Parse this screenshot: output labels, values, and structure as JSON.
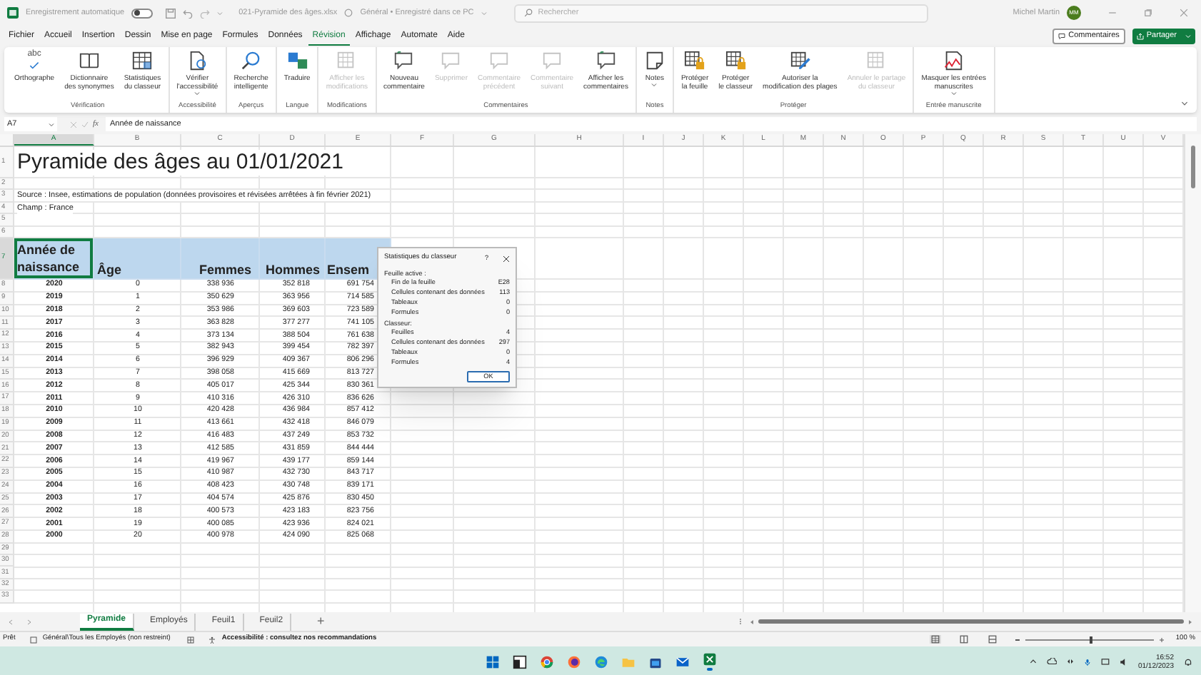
{
  "title_bar": {
    "autosave": {
      "label": "Enregistrement automatique",
      "on": false
    },
    "file_name": "021-Pyramide des âges.xlsx",
    "location": "Général • Enregistré dans ce PC",
    "search_placeholder": "Rechercher",
    "user": "Michel Martin",
    "initials": "MM"
  },
  "menu_tabs": [
    {
      "label": "Fichier",
      "selected": false
    },
    {
      "label": "Accueil",
      "selected": false
    },
    {
      "label": "Insertion",
      "selected": false
    },
    {
      "label": "Dessin",
      "selected": false
    },
    {
      "label": "Mise en page",
      "selected": false
    },
    {
      "label": "Formules",
      "selected": false
    },
    {
      "label": "Données",
      "selected": false
    },
    {
      "label": "Révision",
      "selected": true
    },
    {
      "label": "Affichage",
      "selected": false
    },
    {
      "label": "Automate",
      "selected": false
    },
    {
      "label": "Aide",
      "selected": false
    }
  ],
  "top_buttons": {
    "comments": "Commentaires",
    "share": "Partager"
  },
  "ribbon": [
    {
      "group": "Vérification",
      "buttons": [
        {
          "label": "Orthographe",
          "kind": "spell",
          "glyph": "abc",
          "disabled": false,
          "dropdown": false
        },
        {
          "label": "Dictionnaire\ndes synonymes",
          "kind": "book",
          "disabled": false,
          "dropdown": false
        },
        {
          "label": "Statistiques\ndu classeur",
          "kind": "stats",
          "disabled": false,
          "dropdown": false
        }
      ]
    },
    {
      "group": "Accessibilité",
      "buttons": [
        {
          "label": "Vérifier\nl'accessibilité",
          "kind": "access",
          "disabled": false,
          "dropdown": true
        }
      ]
    },
    {
      "group": "Aperçus",
      "buttons": [
        {
          "label": "Recherche\nintelligente",
          "kind": "search",
          "disabled": false,
          "dropdown": false
        }
      ]
    },
    {
      "group": "Langue",
      "buttons": [
        {
          "label": "Traduire",
          "kind": "translate",
          "disabled": false,
          "dropdown": false
        }
      ]
    },
    {
      "group": "Modifications",
      "buttons": [
        {
          "label": "Afficher les\nmodifications",
          "kind": "grid",
          "disabled": true,
          "dropdown": false
        }
      ]
    },
    {
      "group": "Commentaires",
      "buttons": [
        {
          "label": "Nouveau\ncommentaire",
          "kind": "comment",
          "disabled": false,
          "dropdown": false
        },
        {
          "label": "Supprimer",
          "kind": "comment",
          "disabled": true,
          "dropdown": false
        },
        {
          "label": "Commentaire\nprécédent",
          "kind": "comment",
          "disabled": true,
          "dropdown": false
        },
        {
          "label": "Commentaire\nsuivant",
          "kind": "comment",
          "disabled": true,
          "dropdown": false
        },
        {
          "label": "Afficher les\ncommentaires",
          "kind": "comment",
          "disabled": false,
          "dropdown": false
        }
      ]
    },
    {
      "group": "Notes",
      "buttons": [
        {
          "label": "Notes",
          "kind": "note",
          "disabled": false,
          "dropdown": true
        }
      ]
    },
    {
      "group": "Protéger",
      "buttons": [
        {
          "label": "Protéger\nla feuille",
          "kind": "lock",
          "disabled": false,
          "dropdown": false
        },
        {
          "label": "Protéger\nle classeur",
          "kind": "lock",
          "disabled": false,
          "dropdown": false
        },
        {
          "label": "Autoriser la\nmodification des plages",
          "kind": "edit",
          "disabled": false,
          "dropdown": false
        },
        {
          "label": "Annuler le partage\ndu classeur",
          "kind": "grid",
          "disabled": true,
          "dropdown": false
        }
      ]
    },
    {
      "group": "Entrée manuscrite",
      "buttons": [
        {
          "label": "Masquer les entrées\nmanuscrites",
          "kind": "ink",
          "disabled": false,
          "dropdown": true
        }
      ]
    }
  ],
  "formula_bar": {
    "name_box": "A7",
    "function_label": "fx",
    "value": "Année de naissance"
  },
  "columns": [
    "A",
    "B",
    "C",
    "D",
    "E",
    "F",
    "G",
    "H",
    "I",
    "J",
    "K",
    "L",
    "M",
    "N",
    "O",
    "P",
    "Q",
    "R",
    "S",
    "T",
    "U",
    "V"
  ],
  "rows": [
    {
      "number": "1",
      "kind": "title",
      "text": "Pyramide des âges au 01/01/2021"
    },
    {
      "number": "2"
    },
    {
      "number": "3",
      "kind": "note",
      "text": "Source : Insee, estimations de population (données provisoires et révisées arrêtées à fin février 2021)"
    },
    {
      "number": "4",
      "kind": "note",
      "text": "Champ : France"
    },
    {
      "number": "5"
    },
    {
      "number": "6"
    },
    {
      "number": "7",
      "kind": "header",
      "cells": [
        {
          "text": "Année de\nnaissance",
          "selected": true
        },
        {
          "text": "Âge",
          "selected": false
        },
        {
          "text": "Femmes",
          "selected": false
        },
        {
          "text": "Hommes",
          "selected": false
        },
        {
          "text": "Ensem",
          "selected": false
        }
      ]
    },
    {
      "number": "8",
      "kind": "data",
      "cells": [
        "2020",
        "0",
        "338 936",
        "352 818",
        "691 754"
      ]
    },
    {
      "number": "9",
      "kind": "data",
      "cells": [
        "2019",
        "1",
        "350 629",
        "363 956",
        "714 585"
      ]
    },
    {
      "number": "10",
      "kind": "data",
      "cells": [
        "2018",
        "2",
        "353 986",
        "369 603",
        "723 589"
      ]
    },
    {
      "number": "11",
      "kind": "data",
      "cells": [
        "2017",
        "3",
        "363 828",
        "377 277",
        "741 105"
      ]
    },
    {
      "number": "12",
      "kind": "data",
      "cells": [
        "2016",
        "4",
        "373 134",
        "388 504",
        "761 638"
      ]
    },
    {
      "number": "13",
      "kind": "data",
      "cells": [
        "2015",
        "5",
        "382 943",
        "399 454",
        "782 397"
      ]
    },
    {
      "number": "14",
      "kind": "data",
      "cells": [
        "2014",
        "6",
        "396 929",
        "409 367",
        "806 296"
      ]
    },
    {
      "number": "15",
      "kind": "data",
      "cells": [
        "2013",
        "7",
        "398 058",
        "415 669",
        "813 727"
      ]
    },
    {
      "number": "16",
      "kind": "data",
      "cells": [
        "2012",
        "8",
        "405 017",
        "425 344",
        "830 361"
      ]
    },
    {
      "number": "17",
      "kind": "data",
      "cells": [
        "2011",
        "9",
        "410 316",
        "426 310",
        "836 626"
      ]
    },
    {
      "number": "18",
      "kind": "data",
      "cells": [
        "2010",
        "10",
        "420 428",
        "436 984",
        "857 412"
      ]
    },
    {
      "number": "19",
      "kind": "data",
      "cells": [
        "2009",
        "11",
        "413 661",
        "432 418",
        "846 079"
      ]
    },
    {
      "number": "20",
      "kind": "data",
      "cells": [
        "2008",
        "12",
        "416 483",
        "437 249",
        "853 732"
      ]
    },
    {
      "number": "21",
      "kind": "data",
      "cells": [
        "2007",
        "13",
        "412 585",
        "431 859",
        "844 444"
      ]
    },
    {
      "number": "22",
      "kind": "data",
      "cells": [
        "2006",
        "14",
        "419 967",
        "439 177",
        "859 144"
      ]
    },
    {
      "number": "23",
      "kind": "data",
      "cells": [
        "2005",
        "15",
        "410 987",
        "432 730",
        "843 717"
      ]
    },
    {
      "number": "24",
      "kind": "data",
      "cells": [
        "2004",
        "16",
        "408 423",
        "430 748",
        "839 171"
      ]
    },
    {
      "number": "25",
      "kind": "data",
      "cells": [
        "2003",
        "17",
        "404 574",
        "425 876",
        "830 450"
      ]
    },
    {
      "number": "26",
      "kind": "data",
      "cells": [
        "2002",
        "18",
        "400 573",
        "423 183",
        "823 756"
      ]
    },
    {
      "number": "27",
      "kind": "data",
      "cells": [
        "2001",
        "19",
        "400 085",
        "423 936",
        "824 021"
      ]
    },
    {
      "number": "28",
      "kind": "data",
      "cells": [
        "2000",
        "20",
        "400 978",
        "424 090",
        "825 068"
      ]
    },
    {
      "number": "29"
    },
    {
      "number": "30"
    },
    {
      "number": "31"
    },
    {
      "number": "32"
    },
    {
      "number": "33"
    }
  ],
  "dialog": {
    "title": "Statistiques du classeur",
    "help": "?",
    "sections": [
      {
        "heading": "Feuille active :",
        "items": [
          {
            "label": "Fin de la feuille",
            "value": "E28"
          },
          {
            "label": "Cellules contenant des données",
            "value": "113"
          },
          {
            "label": "Tableaux",
            "value": "0"
          },
          {
            "label": "Formules",
            "value": "0"
          }
        ]
      },
      {
        "heading": "Classeur:",
        "items": [
          {
            "label": "Feuilles",
            "value": "4"
          },
          {
            "label": "Cellules contenant des données",
            "value": "297"
          },
          {
            "label": "Tableaux",
            "value": "0"
          },
          {
            "label": "Formules",
            "value": "4"
          }
        ]
      }
    ],
    "ok": "OK"
  },
  "sheet_tabs": [
    {
      "label": "Pyramide",
      "selected": true
    },
    {
      "label": "Employés",
      "selected": false
    },
    {
      "label": "Feuil1",
      "selected": false
    },
    {
      "label": "Feuil2",
      "selected": false
    }
  ],
  "add_sheet": "+",
  "status_bar": {
    "ready": "Prêt",
    "sensitivity": "Général\\Tous les Employés (non restreint)",
    "accessibility": "Accessibilité : consultez nos recommandations",
    "zoom": {
      "level": 0.5,
      "reading": "100 %"
    }
  },
  "taskbar": {
    "time": "16:52",
    "date": "01/12/2023"
  }
}
